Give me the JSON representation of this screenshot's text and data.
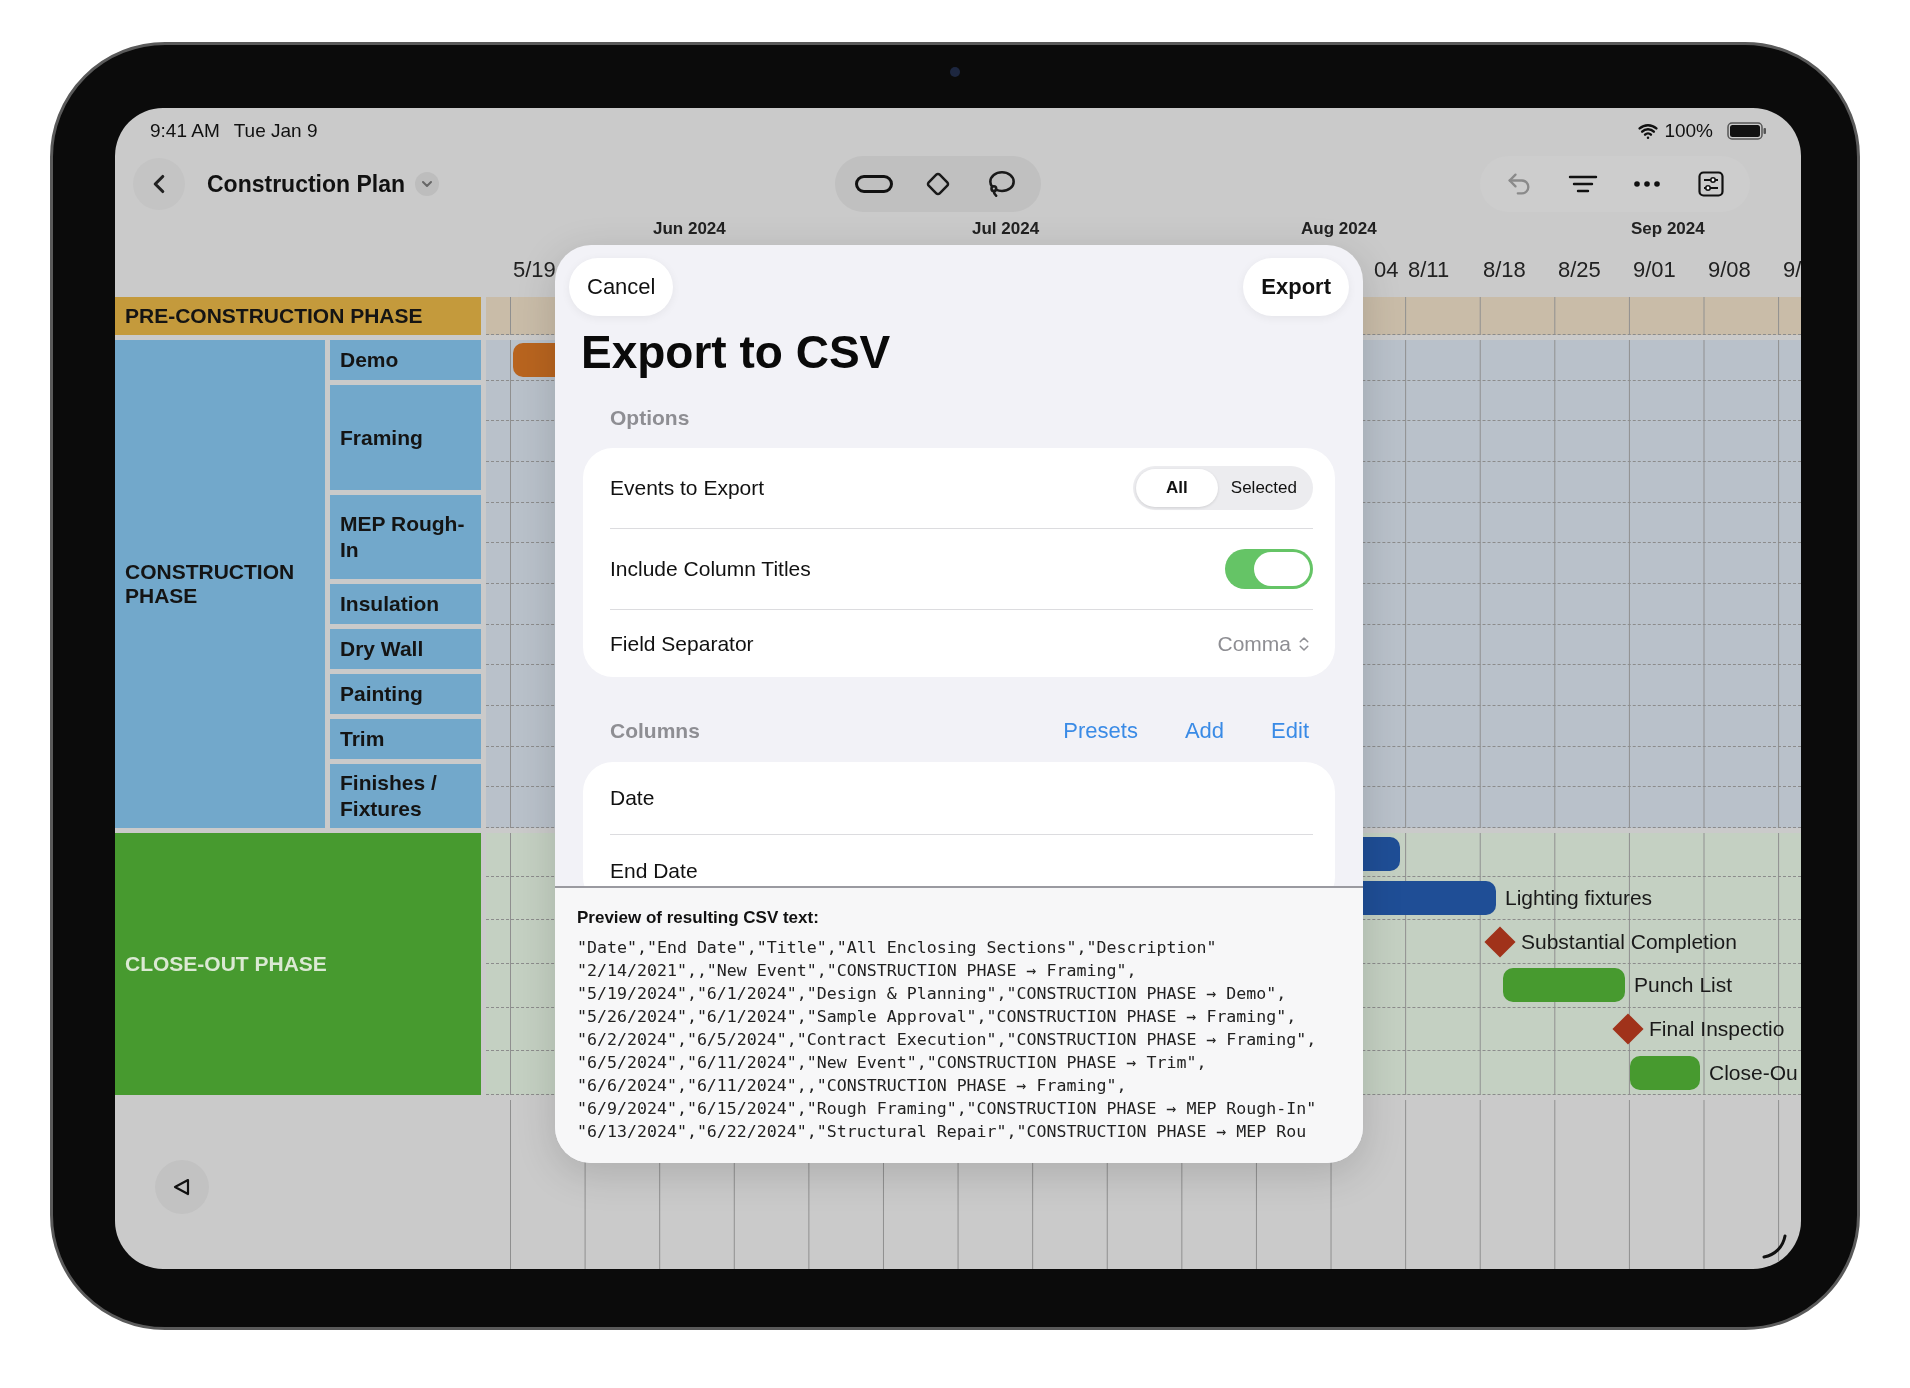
{
  "status_bar": {
    "time": "9:41 AM",
    "date": "Tue Jan 9",
    "battery": "100%"
  },
  "nav": {
    "title": "Construction Plan"
  },
  "timeline": {
    "months": [
      "Jun 2024",
      "Jul 2024",
      "Aug 2024",
      "Sep 2024"
    ],
    "weeks": [
      "5/19",
      "04",
      "8/11",
      "8/18",
      "8/25",
      "9/01",
      "9/08",
      "9/"
    ]
  },
  "sections": [
    {
      "name": "PRE-CONSTRUCTION PHASE",
      "color": "#c49a3c"
    },
    {
      "name": "CONSTRUCTION PHASE",
      "color": "#72a8cb",
      "children": [
        "Demo",
        "Framing",
        "MEP Rough-In",
        "Insulation",
        "Dry Wall",
        "Painting",
        "Trim",
        "Finishes / Fixtures"
      ],
      "events": [
        {
          "kind": "bar",
          "color": "#b8641f"
        }
      ]
    },
    {
      "name": "CLOSE-OUT PHASE",
      "color": "#479a2f",
      "events": [
        {
          "kind": "bar",
          "color": "#1f4e96"
        },
        {
          "kind": "bar",
          "color": "#1f4e96",
          "label": "Lighting fixtures"
        },
        {
          "kind": "milestone",
          "color": "#a0321a",
          "label": "Substantial Completion"
        },
        {
          "kind": "bar",
          "color": "#479a2f",
          "label": "Punch List"
        },
        {
          "kind": "milestone",
          "color": "#a0321a",
          "label": "Final Inspectio"
        },
        {
          "kind": "bar",
          "color": "#479a2f",
          "label": "Close-Ou"
        }
      ]
    }
  ],
  "export_sheet": {
    "cancel": "Cancel",
    "confirm": "Export",
    "title": "Export to CSV",
    "options_header": "Options",
    "events_to_export": {
      "label": "Events to Export",
      "options": [
        {
          "label": "All",
          "selected": true
        },
        {
          "label": "Selected",
          "selected": false
        }
      ]
    },
    "include_column_titles": {
      "label": "Include Column Titles",
      "on": true
    },
    "field_separator": {
      "label": "Field Separator",
      "value": "Comma"
    },
    "columns_header": "Columns",
    "column_actions": [
      "Presets",
      "Add",
      "Edit"
    ],
    "columns": [
      "Date",
      "End Date"
    ],
    "preview_title": "Preview of resulting CSV text:",
    "preview_lines": [
      "\"Date\",\"End Date\",\"Title\",\"All Enclosing Sections\",\"Description\"",
      "\"2/14/2021\",,\"New Event\",\"CONSTRUCTION PHASE → Framing\",",
      "\"5/19/2024\",\"6/1/2024\",\"Design & Planning\",\"CONSTRUCTION PHASE → Demo\",",
      "\"5/26/2024\",\"6/1/2024\",\"Sample Approval\",\"CONSTRUCTION PHASE → Framing\",",
      "\"6/2/2024\",\"6/5/2024\",\"Contract Execution\",\"CONSTRUCTION PHASE → Framing\",",
      "\"6/5/2024\",\"6/11/2024\",\"New Event\",\"CONSTRUCTION PHASE → Trim\",",
      "\"6/6/2024\",\"6/11/2024\",,\"CONSTRUCTION PHASE → Framing\",",
      "\"6/9/2024\",\"6/15/2024\",\"Rough Framing\",\"CONSTRUCTION PHASE → MEP Rough-In\"",
      "\"6/13/2024\",\"6/22/2024\",\"Structural Repair\",\"CONSTRUCTION PHASE → MEP Rou"
    ]
  }
}
